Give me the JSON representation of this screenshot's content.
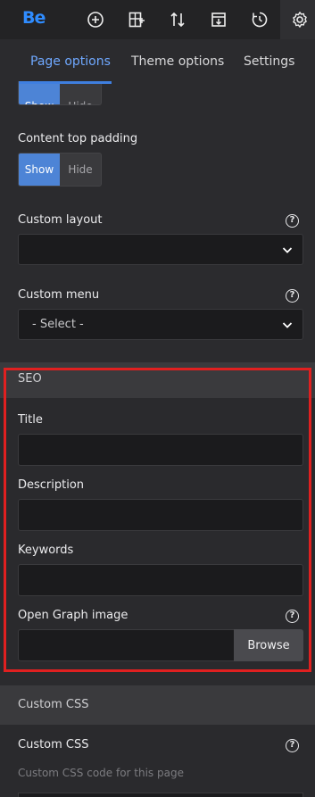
{
  "toolbar": {
    "logo": "Be",
    "icons": [
      "add-icon",
      "layout-icon",
      "sort-icon",
      "export-icon",
      "history-icon",
      "settings-icon"
    ]
  },
  "tabs": [
    {
      "label": "Page options",
      "active": true
    },
    {
      "label": "Theme options",
      "active": false
    },
    {
      "label": "Settings",
      "active": false
    }
  ],
  "page_options": {
    "top_toggle": {
      "show": "Show",
      "hide": "Hide",
      "selected": "Show"
    },
    "content_top_padding": {
      "label": "Content top padding",
      "show": "Show",
      "hide": "Hide",
      "selected": "Show"
    },
    "custom_layout": {
      "label": "Custom layout",
      "help": "?",
      "value": ""
    },
    "custom_menu": {
      "label": "Custom menu",
      "help": "?",
      "value": "- Select -"
    }
  },
  "seo": {
    "header": "SEO",
    "title": {
      "label": "Title",
      "value": ""
    },
    "description": {
      "label": "Description",
      "value": ""
    },
    "keywords": {
      "label": "Keywords",
      "value": ""
    },
    "og_image": {
      "label": "Open Graph image",
      "help": "?",
      "value": "",
      "button": "Browse"
    }
  },
  "custom_css": {
    "header": "Custom CSS",
    "label": "Custom CSS",
    "help": "?",
    "hint": "Custom CSS code for this page"
  },
  "colors": {
    "accent": "#4d84d6",
    "highlight": "#e02020"
  }
}
